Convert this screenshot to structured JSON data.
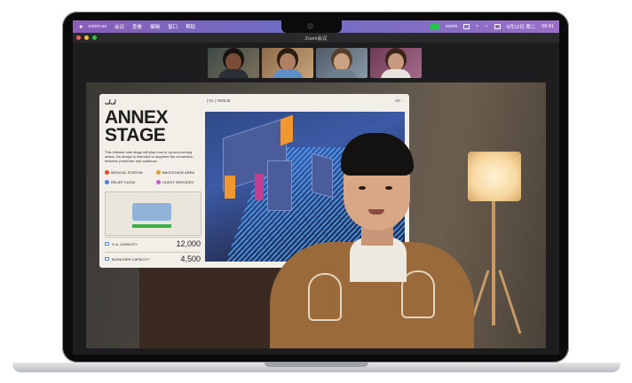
{
  "menubar": {
    "app": "zoom.us",
    "items": [
      "会议",
      "查看",
      "编辑",
      "窗口",
      "帮助"
    ],
    "zoom_label": "zoom",
    "date": "9月12日 周二",
    "time": "09:41"
  },
  "window": {
    "title": "Zoom会议"
  },
  "slide": {
    "logo": "ᴗ/ᴗ/",
    "venue": "| 01 | VENUE",
    "version": "V2 ↑",
    "title": "ANNEX STAGE",
    "description": "This intimate side stage will play host to up-and-coming artists. No design is intended to augment the connection between performer and audience.",
    "legend": [
      "MEDICAL STATION",
      "BACKSTAGE AREA",
      "RELIEF KIOSK",
      "GUEST SERVICES"
    ],
    "stats": [
      {
        "label": "G.A. CAPACITY",
        "value": "12,000"
      },
      {
        "label": "BLEACHER CAPACITY",
        "value": "4,500"
      }
    ]
  },
  "colors": {
    "menubar_left": "#8b5fb7",
    "menubar_right": "#9b6fc7",
    "zoom_green": "#27c24c",
    "legend_red": "#e8432e",
    "legend_orange": "#f2962e",
    "legend_blue": "#4a7fe0",
    "legend_pink": "#c75fd0"
  }
}
